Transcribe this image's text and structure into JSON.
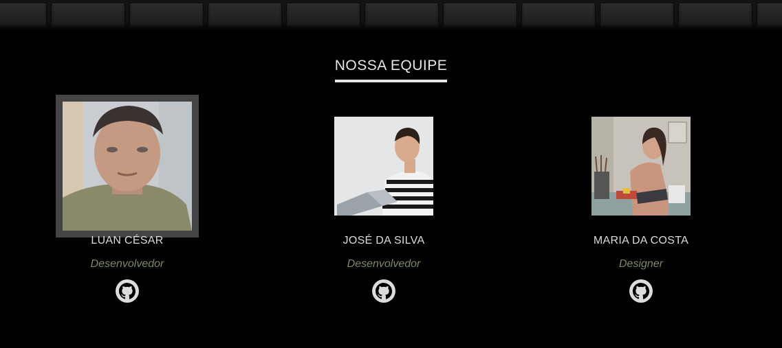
{
  "section": {
    "title": "NOSSA EQUIPE"
  },
  "team": [
    {
      "name": "LUAN CÉSAR",
      "role": "Desenvolvedor",
      "icon": "github-icon"
    },
    {
      "name": "JOSÉ DA SILVA",
      "role": "Desenvolvedor",
      "icon": "github-icon"
    },
    {
      "name": "MARIA DA COSTA",
      "role": "Designer",
      "icon": "github-icon"
    }
  ],
  "colors": {
    "background": "#000000",
    "title": "#e6e6e6",
    "name": "#dcdcdc",
    "role": "#7b8a6a",
    "hover_frame": "#444444"
  }
}
